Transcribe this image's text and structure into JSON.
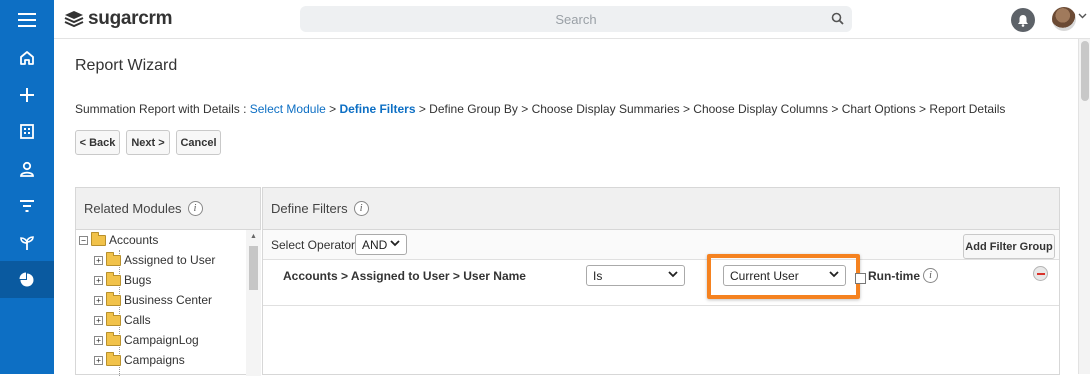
{
  "header": {
    "logo_text": "sugarcrm",
    "search_placeholder": "Search"
  },
  "sidebar": {
    "items": [
      {
        "icon": "home-icon"
      },
      {
        "icon": "plus-icon"
      },
      {
        "icon": "building-icon"
      },
      {
        "icon": "person-icon"
      },
      {
        "icon": "filter-icon"
      },
      {
        "icon": "plant-icon"
      },
      {
        "icon": "pie-chart-icon",
        "active": true
      }
    ]
  },
  "page": {
    "title": "Report Wizard",
    "breadcrumb": {
      "prefix": "Summation Report with Details : ",
      "step1": "Select Module",
      "sep": " > ",
      "step2": "Define Filters",
      "rest": " > Define Group By > Choose Display Summaries > Choose Display Columns > Chart Options > Report Details"
    },
    "buttons": {
      "back": "< Back",
      "next": "Next >",
      "cancel": "Cancel"
    }
  },
  "related_modules": {
    "title": "Related Modules",
    "info": "i",
    "tree": [
      {
        "label": "Accounts",
        "expander": "−",
        "level": 0
      },
      {
        "label": "Assigned to User",
        "expander": "+",
        "level": 1
      },
      {
        "label": "Bugs",
        "expander": "+",
        "level": 1
      },
      {
        "label": "Business Center",
        "expander": "+",
        "level": 1
      },
      {
        "label": "Calls",
        "expander": "+",
        "level": 1
      },
      {
        "label": "CampaignLog",
        "expander": "+",
        "level": 1
      },
      {
        "label": "Campaigns",
        "expander": "+",
        "level": 1
      }
    ]
  },
  "define_filters": {
    "title": "Define Filters",
    "info": "i",
    "operator_label": "Select Operator:",
    "operator_value": "AND",
    "add_filter_group": "Add Filter Group",
    "filter": {
      "field_path": "Accounts > Assigned to User > User Name",
      "comparator": "Is",
      "value": "Current User",
      "runtime_label": "Run-time",
      "info": "i"
    }
  },
  "colors": {
    "brand_blue": "#0d6fc4",
    "highlight_orange": "#f58220"
  }
}
